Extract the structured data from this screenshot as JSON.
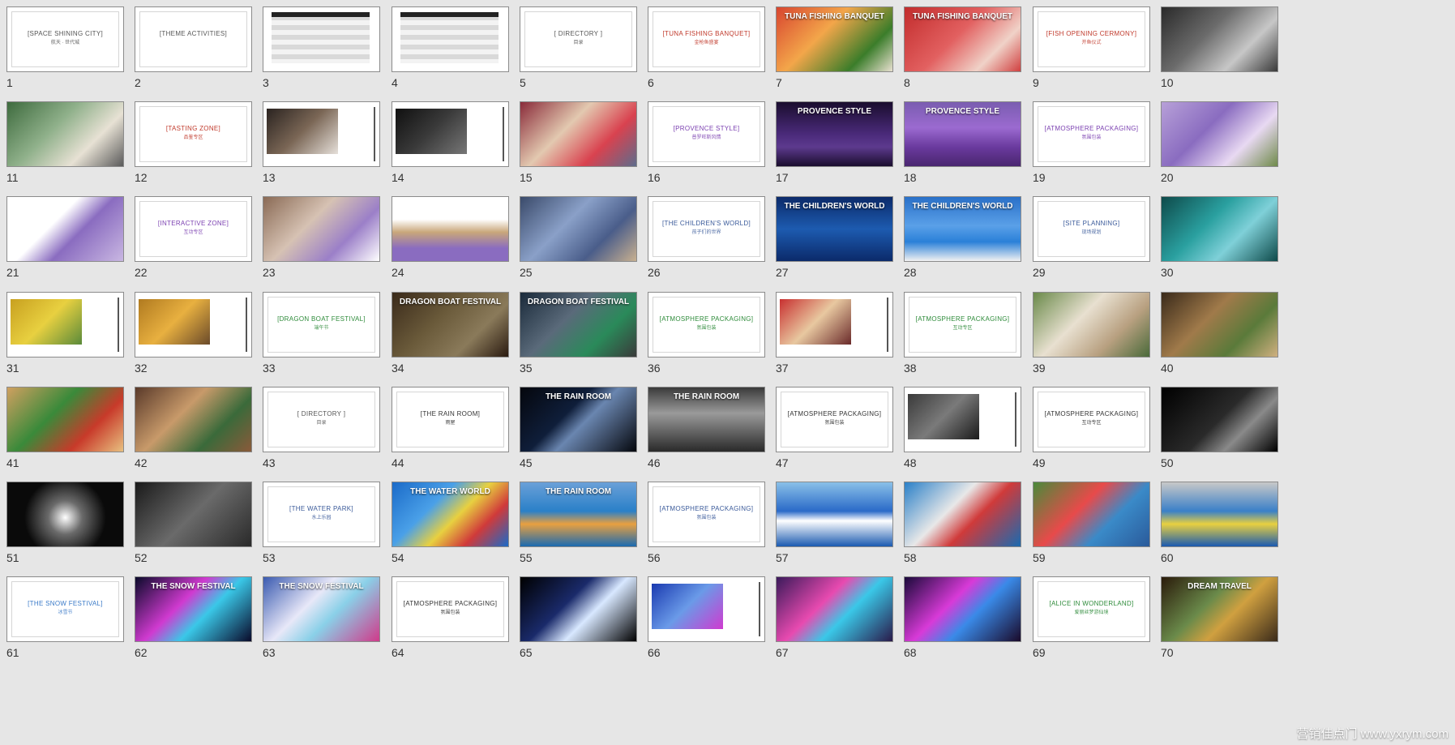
{
  "slides": [
    {
      "n": "1",
      "kind": "title",
      "title": "[SPACE SHINING CITY]",
      "sub": "航天 · 世代城",
      "color": "#555555"
    },
    {
      "n": "2",
      "kind": "title",
      "title": "[THEME ACTIVITIES]",
      "sub": "",
      "color": "#555555"
    },
    {
      "n": "3",
      "kind": "table"
    },
    {
      "n": "4",
      "kind": "table"
    },
    {
      "n": "5",
      "kind": "title",
      "title": "[ DIRECTORY ]",
      "sub": "目录",
      "color": "#555555"
    },
    {
      "n": "6",
      "kind": "title",
      "title": "[TUNA FISHING BANQUET]",
      "sub": "金枪鱼盛宴",
      "color": "#c0392b"
    },
    {
      "n": "7",
      "kind": "photo",
      "overlay": "TUNA FISHING BANQUET",
      "bg": "linear-gradient(135deg,#d8452f,#f3a64a 40%,#3b7d2a 75%,#e8e0d0)"
    },
    {
      "n": "8",
      "kind": "photo",
      "overlay": "TUNA FISHING BANQUET",
      "bg": "linear-gradient(135deg,#c22c2c,#e26060 45%,#f0d2c8 75%,#d04040)"
    },
    {
      "n": "9",
      "kind": "title",
      "title": "[FISH OPENING CERMONY]",
      "sub": "开鱼仪式",
      "color": "#c0392b"
    },
    {
      "n": "10",
      "kind": "photo",
      "overlay": "",
      "bg": "linear-gradient(135deg,#2a2a2a,#6b6b6b 40%,#c7c7c7 70%,#3a3a3a)"
    },
    {
      "n": "11",
      "kind": "photo",
      "overlay": "",
      "bg": "linear-gradient(135deg,#3e6b3e,#8fb08a 40%,#e7e1d4 70%,#5a5a5a)"
    },
    {
      "n": "12",
      "kind": "title",
      "title": "[TASTING ZONE]",
      "sub": "品鉴专区",
      "color": "#c0392b"
    },
    {
      "n": "13",
      "kind": "split",
      "bg": "linear-gradient(135deg,#2a2320,#7a6655 50%,#e6e0da)"
    },
    {
      "n": "14",
      "kind": "split",
      "bg": "linear-gradient(135deg,#101010,#3a3a3a 50%,#777)"
    },
    {
      "n": "15",
      "kind": "photo",
      "overlay": "",
      "bg": "linear-gradient(135deg,#8a2b3a,#e3c9b0 40%,#d9424f 70%,#5d6c8c)"
    },
    {
      "n": "16",
      "kind": "title",
      "title": "[PROVENCE STYLE]",
      "sub": "普罗旺斯风情",
      "color": "#7a3fb0"
    },
    {
      "n": "17",
      "kind": "photo",
      "overlay": "PROVENCE STYLE",
      "bg": "linear-gradient(180deg,#1a0d2e,#4a2a7a 50%,#5d3a8e 70%,#1a0d2e)"
    },
    {
      "n": "18",
      "kind": "photo",
      "overlay": "PROVENCE STYLE",
      "bg": "linear-gradient(180deg,#7a5db0,#9b6ad0 40%,#6a3a9e 70%,#4a2670)"
    },
    {
      "n": "19",
      "kind": "title",
      "title": "[ATMOSPHERE PACKAGING]",
      "sub": "氛围包装",
      "color": "#7a3fb0"
    },
    {
      "n": "20",
      "kind": "photo",
      "overlay": "",
      "bg": "linear-gradient(135deg,#b7a0d8,#8a6cc0 40%,#e8d9f2 70%,#6f8a4a)"
    },
    {
      "n": "21",
      "kind": "photo",
      "overlay": "",
      "bg": "linear-gradient(135deg,#ffffff 40%,#8a6cc0 60%,#c9b7e2)"
    },
    {
      "n": "22",
      "kind": "title",
      "title": "[INTERACTIVE ZONE]",
      "sub": "互动专区",
      "color": "#7a3fb0"
    },
    {
      "n": "23",
      "kind": "photo",
      "overlay": "",
      "bg": "linear-gradient(135deg,#8a6a55,#d6c2b3 40%,#9b7fc8 70%,#ffffff)"
    },
    {
      "n": "24",
      "kind": "photo",
      "overlay": "",
      "bg": "linear-gradient(180deg,#ffffff 35%,#c9a77a 55%,#8a6cc0 80%)"
    },
    {
      "n": "25",
      "kind": "photo",
      "overlay": "",
      "bg": "linear-gradient(135deg,#3a4a6a,#8aa0c8 40%,#4a5d8a 70%,#c8b090)"
    },
    {
      "n": "26",
      "kind": "title",
      "title": "[THE CHILDREN'S WORLD]",
      "sub": "孩子们的世界",
      "color": "#3a5a9a"
    },
    {
      "n": "27",
      "kind": "photo",
      "overlay": "THE CHILDREN'S WORLD",
      "bg": "linear-gradient(180deg,#0b2a6a,#1d5bb0 50%,#0b2a6a)"
    },
    {
      "n": "28",
      "kind": "photo",
      "overlay": "THE CHILDREN'S WORLD",
      "bg": "linear-gradient(180deg,#2a70c8,#5aa0e8 45%,#2a80d8 70%,#f2f2f2)"
    },
    {
      "n": "29",
      "kind": "title",
      "title": "[SITE PLANNING]",
      "sub": "现场规划",
      "color": "#3a5a9a"
    },
    {
      "n": "30",
      "kind": "photo",
      "overlay": "",
      "bg": "linear-gradient(135deg,#0e4a4a,#2aa0a0 40%,#7fd0d8 65%,#0e4a4a)"
    },
    {
      "n": "31",
      "kind": "split",
      "bg": "linear-gradient(135deg,#c8a020,#e8d040 50%,#5a8a3a)"
    },
    {
      "n": "32",
      "kind": "split",
      "bg": "linear-gradient(135deg,#b07a20,#e8b040 50%,#6a4a2a)"
    },
    {
      "n": "33",
      "kind": "title",
      "title": "[DRAGON BOAT FESTIVAL]",
      "sub": "端午节",
      "color": "#2e8b3a"
    },
    {
      "n": "34",
      "kind": "photo",
      "overlay": "DRAGON BOAT FESTIVAL",
      "bg": "linear-gradient(135deg,#3a2a1a,#6a5a3a 40%,#8a7a5a 70%,#2a1a10)"
    },
    {
      "n": "35",
      "kind": "photo",
      "overlay": "DRAGON BOAT FESTIVAL",
      "bg": "linear-gradient(135deg,#1a2a3a,#5a6a7a 40%,#2a8a5a 70%,#3a3a3a)"
    },
    {
      "n": "36",
      "kind": "title",
      "title": "[ATMOSPHERE PACKAGING]",
      "sub": "氛围包装",
      "color": "#2e8b3a"
    },
    {
      "n": "37",
      "kind": "split",
      "bg": "linear-gradient(135deg,#c83030,#e8c8a0 50%,#6a2a2a)"
    },
    {
      "n": "38",
      "kind": "title",
      "title": "[ATMOSPHERE PACKAGING]",
      "sub": "互动专区",
      "color": "#2e8b3a"
    },
    {
      "n": "39",
      "kind": "photo",
      "overlay": "",
      "bg": "linear-gradient(135deg,#6a8a4a,#e8e0d0 40%,#b8a080 70%,#4a6a3a)"
    },
    {
      "n": "40",
      "kind": "photo",
      "overlay": "",
      "bg": "linear-gradient(135deg,#3a2a1a,#a07a4a 40%,#5a7a3a 70%,#d0b080)"
    },
    {
      "n": "41",
      "kind": "photo",
      "overlay": "",
      "bg": "linear-gradient(135deg,#d0a060,#3a8a3a 40%,#c83a2a 70%,#e8c080)"
    },
    {
      "n": "42",
      "kind": "photo",
      "overlay": "",
      "bg": "linear-gradient(135deg,#5a3a2a,#c89a6a 40%,#3a6a3a 70%,#8a5a3a)"
    },
    {
      "n": "43",
      "kind": "title",
      "title": "[ DIRECTORY ]",
      "sub": "目录",
      "color": "#555555"
    },
    {
      "n": "44",
      "kind": "title",
      "title": "[THE RAIN ROOM]",
      "sub": "雨屋",
      "color": "#333333"
    },
    {
      "n": "45",
      "kind": "photo",
      "overlay": "THE RAIN ROOM",
      "bg": "linear-gradient(135deg,#05070d,#0f1e3a 40%,#6a86b0 55%,#05070d)"
    },
    {
      "n": "46",
      "kind": "photo",
      "overlay": "THE RAIN ROOM",
      "bg": "linear-gradient(180deg,#3a3a3a,#9a9a9a 40%,#2a2a2a)"
    },
    {
      "n": "47",
      "kind": "title",
      "title": "[ATMOSPHERE PACKAGING]",
      "sub": "氛围包装",
      "color": "#333333"
    },
    {
      "n": "48",
      "kind": "split",
      "bg": "linear-gradient(135deg,#3a3a3a,#7a7a7a 50%,#1a1a1a)"
    },
    {
      "n": "49",
      "kind": "title",
      "title": "[ATMOSPHERE PACKAGING]",
      "sub": "互动专区",
      "color": "#333333"
    },
    {
      "n": "50",
      "kind": "photo",
      "overlay": "",
      "bg": "linear-gradient(135deg,#000000,#2a2a2a 50%,#8a8a8a 70%,#000000)"
    },
    {
      "n": "51",
      "kind": "photo",
      "overlay": "",
      "bg": "radial-gradient(circle at 50% 55%,#ffffff,#6a6a6a 25%,#0a0a0a 60%)"
    },
    {
      "n": "52",
      "kind": "photo",
      "overlay": "",
      "bg": "linear-gradient(135deg,#1a1a1a,#6a6a6a 50%,#2a2a2a)"
    },
    {
      "n": "53",
      "kind": "title",
      "title": "[THE WATER PARK]",
      "sub": "水上乐园",
      "color": "#3a5a9a"
    },
    {
      "n": "54",
      "kind": "photo",
      "overlay": "THE WATER WORLD",
      "bg": "linear-gradient(135deg,#1a6ac8,#4aa0e8 35%,#e8d040 55%,#d03a3a 75%,#1a6ac8)"
    },
    {
      "n": "55",
      "kind": "photo",
      "overlay": "THE RAIN ROOM",
      "bg": "linear-gradient(180deg,#6aa0d8,#2a80c8 45%,#e8a040 65%,#1a6ab0)"
    },
    {
      "n": "56",
      "kind": "title",
      "title": "[ATMOSPHERE PACKAGING]",
      "sub": "氛围包装",
      "color": "#3a5a9a"
    },
    {
      "n": "57",
      "kind": "photo",
      "overlay": "",
      "bg": "linear-gradient(180deg,#8ac0e8,#2a6ac8 45%,#ffffff 60%,#1a5ab0)"
    },
    {
      "n": "58",
      "kind": "photo",
      "overlay": "",
      "bg": "linear-gradient(135deg,#2a80c8,#e8e8e8 40%,#d03a3a 60%,#1a6ab0)"
    },
    {
      "n": "59",
      "kind": "photo",
      "overlay": "",
      "bg": "linear-gradient(135deg,#4a8a3a,#e84a4a 40%,#3a8ac8 65%,#2a5a9a)"
    },
    {
      "n": "60",
      "kind": "photo",
      "overlay": "",
      "bg": "linear-gradient(180deg,#c8c8c8,#3a80c8 45%,#e8d040 65%,#1a5ab0)"
    },
    {
      "n": "61",
      "kind": "title",
      "title": "[THE SNOW FESTIVAL]",
      "sub": "冰雪节",
      "color": "#3a7ac8"
    },
    {
      "n": "62",
      "kind": "photo",
      "overlay": "THE SNOW FESTIVAL",
      "bg": "linear-gradient(135deg,#0a0a2a,#d03ad0 40%,#3ac8e8 60%,#0a0a2a)"
    },
    {
      "n": "63",
      "kind": "photo",
      "overlay": "THE SNOW FESTIVAL",
      "bg": "linear-gradient(135deg,#3a5ab0,#e8e8f8 40%,#8ad0e8 60%,#d03a8a)"
    },
    {
      "n": "64",
      "kind": "title",
      "title": "[ATMOSPHERE PACKAGING]",
      "sub": "氛围包装",
      "color": "#333333"
    },
    {
      "n": "65",
      "kind": "photo",
      "overlay": "",
      "bg": "linear-gradient(135deg,#000000,#1a2a6a 40%,#d8e8ff 60%,#000000)"
    },
    {
      "n": "66",
      "kind": "split",
      "bg": "linear-gradient(135deg,#1a3ab0,#6a9ae8 50%,#d03ad0)"
    },
    {
      "n": "67",
      "kind": "photo",
      "overlay": "",
      "bg": "linear-gradient(135deg,#3a1a5a,#e84ab0 40%,#3ac8e8 60%,#2a1a4a)"
    },
    {
      "n": "68",
      "kind": "photo",
      "overlay": "",
      "bg": "linear-gradient(135deg,#1a0a3a,#d83ad8 40%,#3a8ae8 60%,#1a0a2a)"
    },
    {
      "n": "69",
      "kind": "title",
      "title": "[ALICE IN WONDERLAND]",
      "sub": "爱丽丝梦游仙境",
      "color": "#2e8b3a"
    },
    {
      "n": "70",
      "kind": "photo",
      "overlay": "DREAM TRAVEL",
      "bg": "linear-gradient(135deg,#2a1a0a,#6a8a4a 40%,#d0a040 60%,#3a2a1a)"
    }
  ],
  "watermark": "营销佳点门 www.yxrym.com"
}
